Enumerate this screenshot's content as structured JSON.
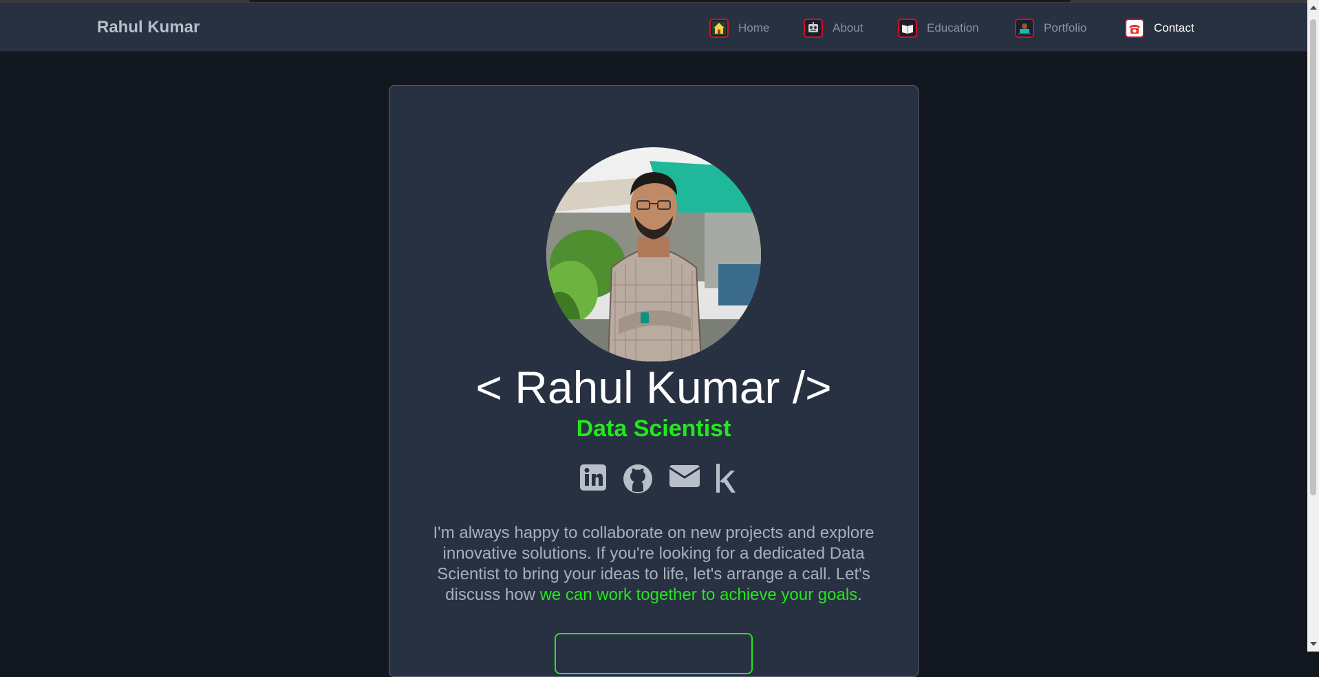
{
  "navbar": {
    "brand": "Rahul Kumar",
    "items": [
      {
        "label": "Home",
        "icon": "house-icon"
      },
      {
        "label": "About",
        "icon": "robot-icon"
      },
      {
        "label": "Education",
        "icon": "book-icon"
      },
      {
        "label": "Portfolio",
        "icon": "laptop-icon"
      },
      {
        "label": "Contact",
        "icon": "telephone-icon",
        "active": true
      }
    ]
  },
  "profile": {
    "title": "< Rahul Kumar />",
    "subtitle": "Data Scientist",
    "description_main": "I'm always happy to collaborate on new projects and explore innovative solutions. If you're looking for a dedicated Data Scientist to bring your ideas to life, let's arrange a call. Let's discuss how ",
    "description_highlight": "we can work together to achieve your goals",
    "description_end": "."
  },
  "social": [
    "linkedin-icon",
    "github-icon",
    "mail-icon",
    "kaggle-icon"
  ],
  "colors": {
    "background": "#121720",
    "navbar": "#283142",
    "card": "#283142",
    "accent": "#22e81c",
    "icon": "#b9bfc9"
  }
}
